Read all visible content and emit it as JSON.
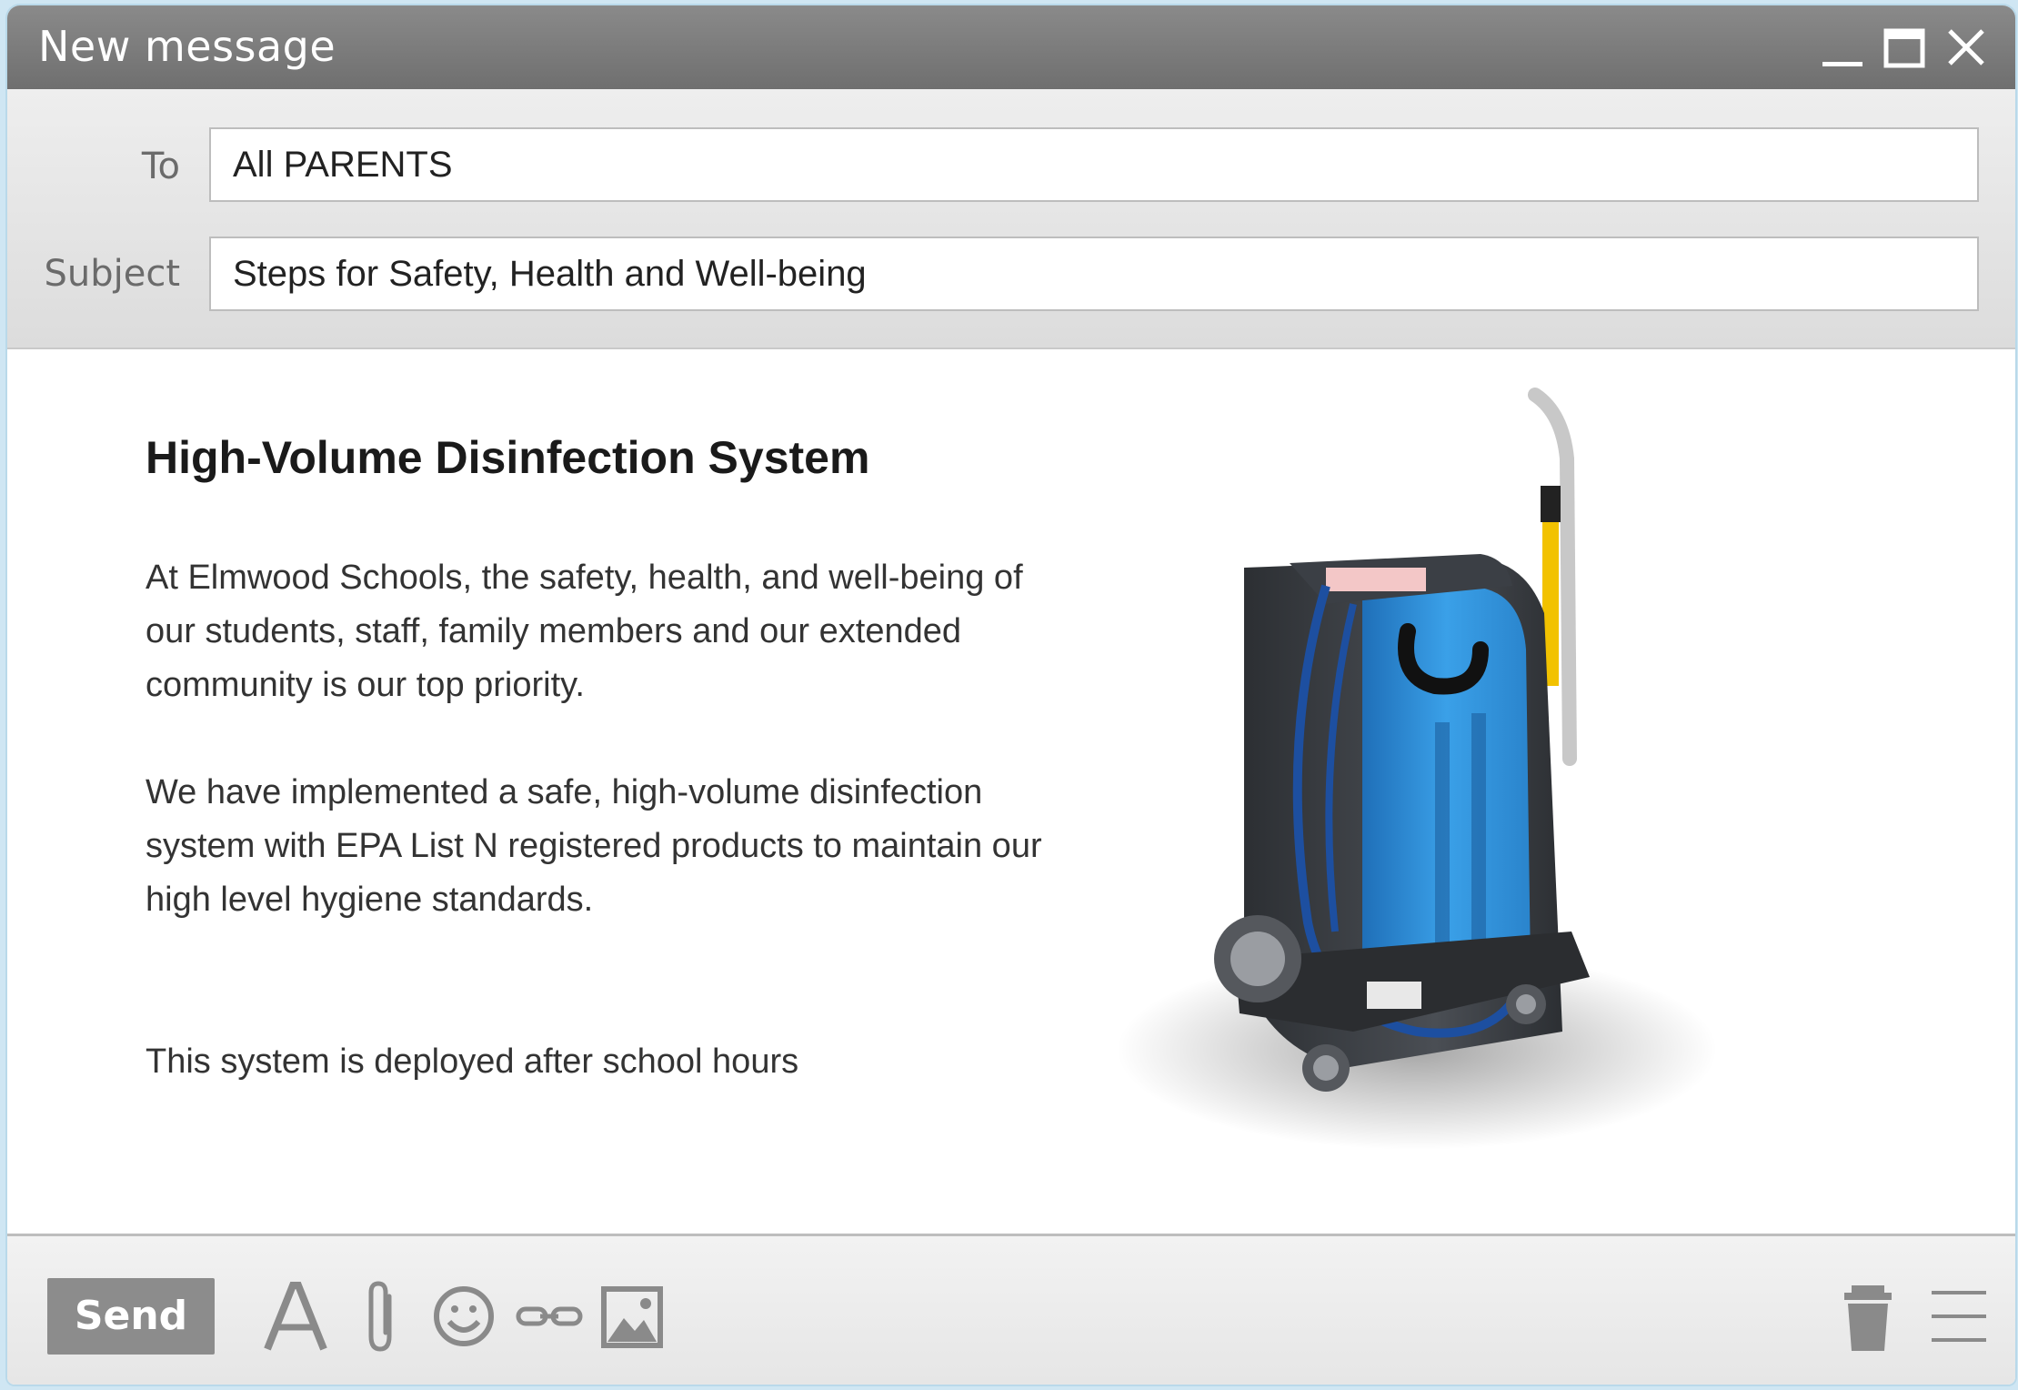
{
  "window": {
    "title": "New message"
  },
  "header": {
    "to_label": "To",
    "to_value": "All PARENTS",
    "subject_label": "Subject",
    "subject_value": "Steps for Safety, Health and Well-being"
  },
  "body": {
    "heading": "High-Volume Disinfection System",
    "paragraphs": [
      "At Elmwood Schools, the safety, health, and well-being of our students, staff, family members and our extended community is our top priority.",
      "We have implemented a safe, high-volume disinfection system with EPA List N registered products to maintain our high level hygiene standards.",
      "This system is deployed after school hours"
    ],
    "image": "disinfection-machine-image"
  },
  "footer": {
    "send_label": "Send",
    "tools": [
      "font-icon",
      "attachment-icon",
      "emoji-icon",
      "link-icon",
      "image-icon"
    ],
    "right_tools": [
      "trash-icon",
      "menu-icon"
    ]
  },
  "colors": {
    "titlebar": "#7a7a7a",
    "send_button": "#8c8c8c",
    "machine_blue": "#2f8fd8",
    "machine_dark": "#3a3d42"
  }
}
